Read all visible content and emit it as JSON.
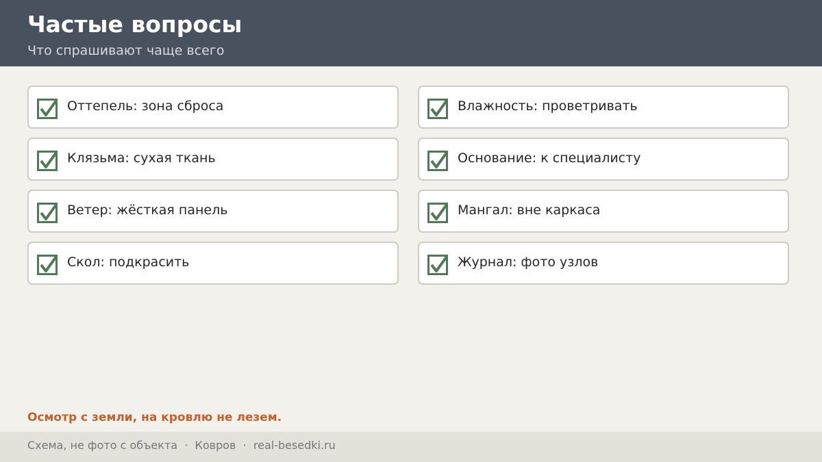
{
  "header": {
    "title": "Частые вопросы",
    "subtitle": "Что спрашивают чаще всего"
  },
  "items": {
    "left": [
      {
        "label": "Оттепель: зона сброса",
        "checked": true
      },
      {
        "label": "Клязьма: сухая ткань",
        "checked": true
      },
      {
        "label": "Ветер: жёсткая панель",
        "checked": true
      },
      {
        "label": "Скол: подкрасить",
        "checked": true
      }
    ],
    "right": [
      {
        "label": "Влажность: проветривать",
        "checked": true
      },
      {
        "label": "Основание: к специалисту",
        "checked": true
      },
      {
        "label": "Мангал: вне каркаса",
        "checked": true
      },
      {
        "label": "Журнал: фото узлов",
        "checked": true
      }
    ]
  },
  "note": "Осмотр с земли, на кровлю не лезем.",
  "footer": {
    "text": "Схема, не фото с объекта  ·  Ковров  ·  real-besedki.ru"
  },
  "colors": {
    "header_bg": "#48525e",
    "page_bg": "#f3f1ec",
    "check_green": "#4f7a55",
    "note_orange": "#c0622e",
    "footer_bg": "#e4e1db"
  }
}
